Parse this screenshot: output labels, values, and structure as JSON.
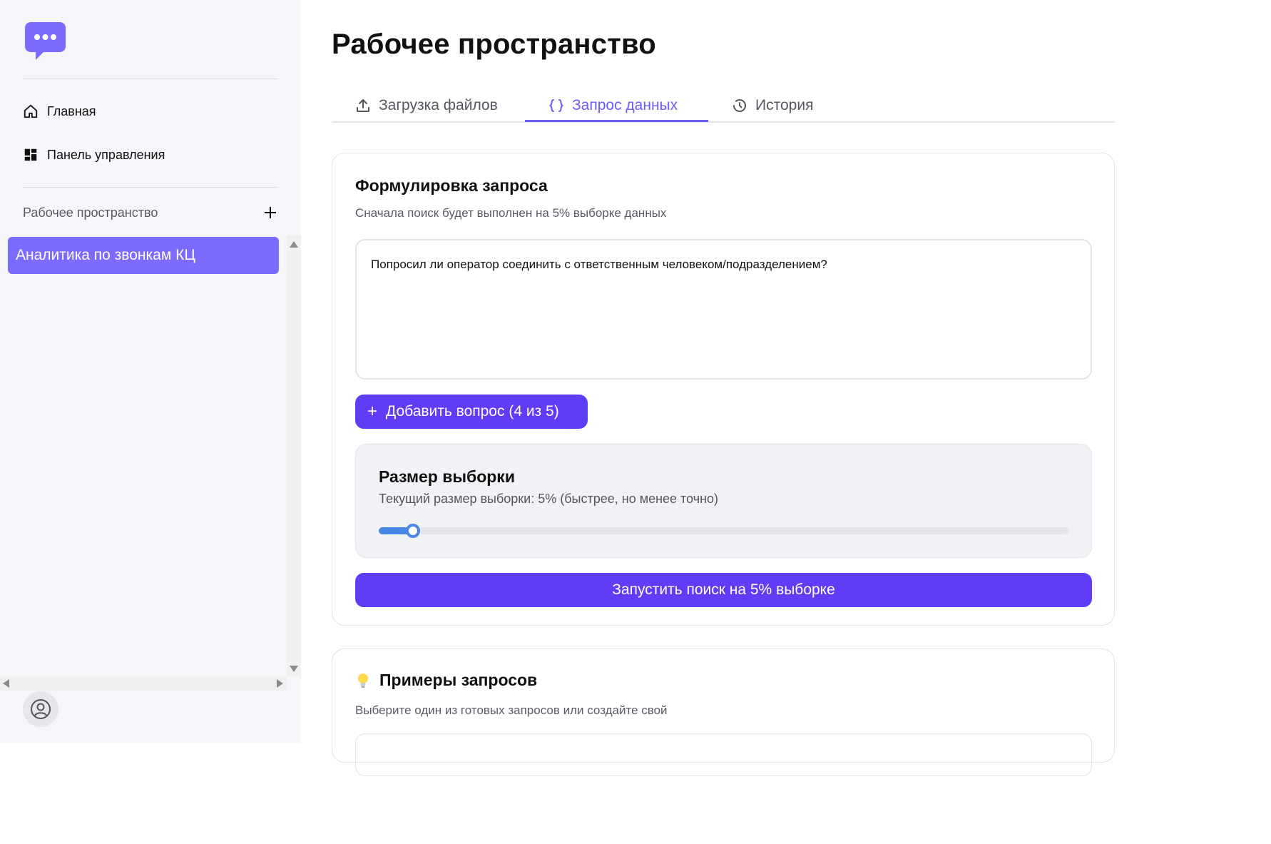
{
  "sidebar": {
    "nav": [
      {
        "label": "Главная",
        "icon": "home-icon"
      },
      {
        "label": "Панель управления",
        "icon": "dashboard-icon"
      }
    ],
    "workspace_section_label": "Рабочее пространство",
    "workspaces": [
      {
        "label": "Аналитика по звонкам КЦ",
        "active": true
      }
    ]
  },
  "page": {
    "title": "Рабочее пространство"
  },
  "tabs": [
    {
      "label": "Загрузка файлов",
      "icon": "upload-icon",
      "active": false
    },
    {
      "label": "Запрос данных",
      "icon": "braces-icon",
      "active": true
    },
    {
      "label": "История",
      "icon": "history-icon",
      "active": false
    }
  ],
  "query_card": {
    "title": "Формулировка запроса",
    "subtitle": "Сначала поиск будет выполнен на 5% выборке данных",
    "query_text": "Попросил ли оператор соединить с ответственным человеком/подразделением?",
    "add_button_label": "Добавить вопрос (4 из 5)",
    "sample": {
      "title": "Размер выборки",
      "subtitle": "Текущий размер выборки: 5% (быстрее, но менее точно)",
      "slider_percent": 5
    },
    "run_button_label": "Запустить поиск на 5% выборке"
  },
  "examples_card": {
    "title": "Примеры запросов",
    "subtitle": "Выберите один из готовых запросов или создайте свой"
  },
  "colors": {
    "accent": "#5f3cf5",
    "accent_light": "#7b6cff",
    "tab_active": "#6b5cf6",
    "slider": "#4a86e8",
    "sidebar_bg": "#f5f5fa"
  }
}
